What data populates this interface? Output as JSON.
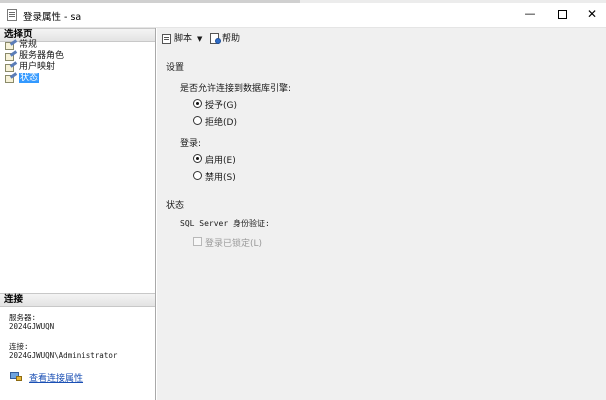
{
  "window": {
    "title": "登录属性 - sa",
    "minimize_glyph": "—",
    "close_glyph": "✕"
  },
  "left": {
    "select_page_header": "选择页",
    "pages": [
      {
        "label": "常规",
        "icon": "page-wrench-icon",
        "selected": false
      },
      {
        "label": "服务器角色",
        "icon": "page-wrench-icon",
        "selected": false
      },
      {
        "label": "用户映射",
        "icon": "page-wrench-icon",
        "selected": false
      },
      {
        "label": "状态",
        "icon": "page-wrench-icon",
        "selected": true
      }
    ],
    "connection_header": "连接",
    "server_label": "服务器:",
    "server_value": "2024GJWUQN",
    "connection_label": "连接:",
    "connection_value": "2024GJWUQN\\Administrator",
    "view_connection_link": "查看连接属性"
  },
  "toolbar": {
    "script_label": "脚本",
    "script_caret": "▼",
    "help_label": "帮助"
  },
  "status_page": {
    "settings_heading": "设置",
    "db_engine_question": "是否允许连接到数据库引擎:",
    "grant_label": "授予(G)",
    "deny_label": "拒绝(D)",
    "login_heading": "登录:",
    "enabled_label": "启用(E)",
    "disabled_label": "禁用(S)",
    "status_heading": "状态",
    "sql_auth_label": "SQL Server 身份验证:",
    "login_locked_label": "登录已锁定(L)",
    "permission": "grant",
    "login_state": "enabled",
    "login_locked": false
  },
  "colors": {
    "selection": "#3399ff",
    "link": "#1a4fb4",
    "right_pane_bg": "#f0f0f0"
  }
}
